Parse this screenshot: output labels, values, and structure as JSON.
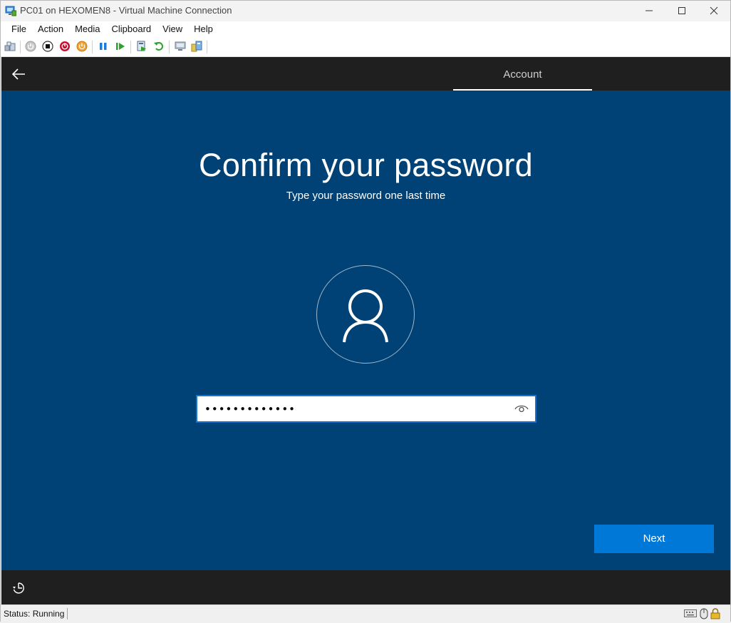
{
  "window": {
    "title": "PC01 on HEXOMEN8 - Virtual Machine Connection",
    "icon": "vm-connection-icon",
    "controls": [
      "minimize-icon",
      "maximize-icon",
      "close-icon"
    ]
  },
  "menu": {
    "items": [
      "File",
      "Action",
      "Media",
      "Clipboard",
      "View",
      "Help"
    ]
  },
  "toolbar": {
    "icons": [
      "ctrl-alt-del-icon",
      "start-icon",
      "turn-off-icon",
      "shut-down-icon",
      "save-icon",
      "pause-icon",
      "resume-icon",
      "checkpoint-icon",
      "revert-icon",
      "enhanced-session-icon",
      "share-icon"
    ]
  },
  "vm": {
    "tab_label": "Account",
    "heading": "Confirm your password",
    "subheading": "Type your password one last time",
    "password_value": "•••••••••••••",
    "next_label": "Next",
    "colors": {
      "background": "#004275",
      "button": "#0078d7",
      "bars": "#1f1f1f"
    }
  },
  "status": {
    "text": "Status: Running"
  }
}
